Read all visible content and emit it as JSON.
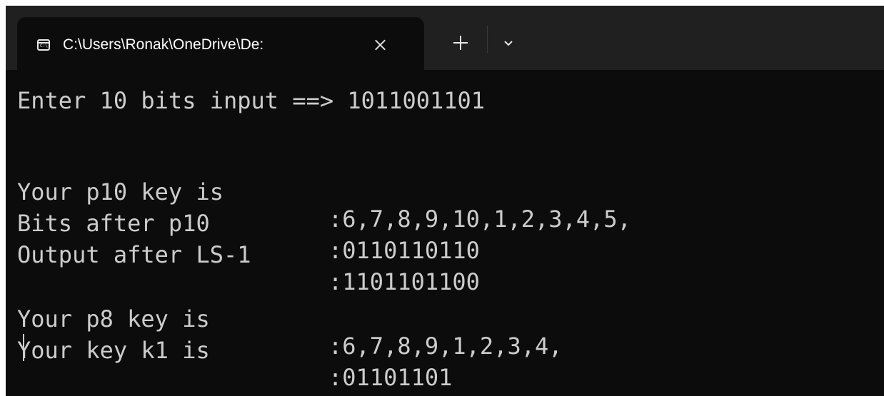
{
  "tab": {
    "title": "C:\\Users\\Ronak\\OneDrive\\De:",
    "icon": "console-icon",
    "icon_text": "C:\\"
  },
  "toolbar": {
    "new_tab_icon": "plus-icon",
    "dropdown_icon": "chevron-down-icon"
  },
  "terminal": {
    "prompt_line": "Enter 10 bits input ==> 1011001101",
    "rows1": [
      {
        "label": "Your p10 key is",
        "value": ":6,7,8,9,10,1,2,3,4,5,"
      },
      {
        "label": "Bits after p10",
        "value": ":0110110110"
      },
      {
        "label": "Output after LS-1",
        "value": ":1101101100"
      }
    ],
    "rows2": [
      {
        "label": "Your p8 key is",
        "value": ":6,7,8,9,1,2,3,4,"
      },
      {
        "label": "Your key k1 is",
        "value": ":01101101"
      }
    ]
  },
  "colors": {
    "background": "#0c0c0c",
    "tabbar": "#202020",
    "text": "#cccccc"
  }
}
